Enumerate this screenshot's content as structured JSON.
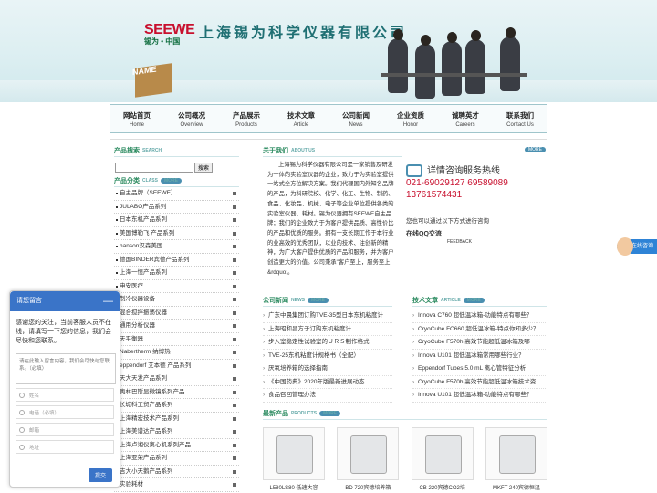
{
  "brand": {
    "logo": "SEEWE",
    "logo_sub": "锡为 • 中国",
    "company": "上海锡为科学仪器有限公司",
    "box_label": "NAME"
  },
  "nav": [
    {
      "zh": "网站首页",
      "en": "Home"
    },
    {
      "zh": "公司概况",
      "en": "Overview"
    },
    {
      "zh": "产品展示",
      "en": "Products"
    },
    {
      "zh": "技术文章",
      "en": "Article"
    },
    {
      "zh": "公司新闻",
      "en": "News"
    },
    {
      "zh": "企业资质",
      "en": "Honor"
    },
    {
      "zh": "诚聘英才",
      "en": "Careers"
    },
    {
      "zh": "联系我们",
      "en": "Contact Us"
    }
  ],
  "sidebar": {
    "search_title": "产品搜索",
    "search_en": "SEARCH",
    "search_button": "搜索",
    "class_title": "产品分类",
    "class_en": "CLASS",
    "more": "MORE",
    "categories": [
      "自主品牌（SEEWE）",
      "JULABO产品系列",
      "日本东机产品系列",
      "美国博勒飞 产品系列",
      "hanson汉森美国",
      "德国BINDER宾德产品系列",
      "上海一恒产品系列",
      "申安医疗",
      "制冷仪器设备",
      "混合搅拌振荡仪器",
      "通用分析仪器",
      "天平衡器",
      "Nabertherm 纳博热",
      "eppendorf 艾本德 产品系列",
      "天大天发产品系列",
      "奥林巴斯显微镜系列产品",
      "长城科工贸产品系列",
      "上海精宏技术产品系列",
      "上海美谱达产品系列",
      "上海卢湘仪离心机系列产品",
      "上海亚荣产品系列",
      "吉大小天鹅产品系列",
      "实验耗材"
    ]
  },
  "about": {
    "title": "关于我们",
    "en": "ABOUT US",
    "more": "MORE",
    "text": "上海锡为科学仪器有限公司是一家销售及研发为一体的实验室仪器的企业，致力于为实验室提供一站式全方位解决方案。我们代理国内外知名品牌的产品，为科研院校、化学、化工、生物、制药、食品、化妆品、机械、电子等企业单位提供各类的实验室仪器、耗材。锡为仪器拥有SEEWE自主品牌；我们的企业致力于为客户提供品质、高性价比的产品和优质的服务。拥有一支长期工作于本行业的业高效的优秀团队，以业的技术、注创新的精神，为广大客户提供优质的产品和服务，并为客户创造更大的价值。公司秉承\"客户至上，服务至上&rdquo;。"
  },
  "contact": {
    "title": "详情咨询服务热线",
    "phone1": "021-69029127 69589089",
    "phone2": "13761574431",
    "qq_text": "您也可以通过以下方式进行咨询",
    "qq_label": "在线QQ交流",
    "qq_brand": "FEEDBACK"
  },
  "news": {
    "title": "公司新闻",
    "en": "NEWS",
    "more": "MORE",
    "items": [
      "广东中晨集团订购TVE-35型日本东机粘度计",
      "上海昭和昌方子订购东机粘度计",
      "步入室稳定性试验室的ＵＲＳ制作格式",
      "TVE-25东机粘度计规格书（全配）",
      "厌氧培养箱的选择指南",
      "《中国药典》2020年版最新进展动态",
      "食品召回管理办法"
    ]
  },
  "tech": {
    "title": "技术文章",
    "en": "ARTICLE",
    "more": "MORE",
    "items": [
      "Innova C760 超低温冰箱-功能特点有哪些？",
      "CryoCube FC660 超低温冰箱-特点你知多少？",
      "CryoCube F570h 高效节能超低温冰箱及哪",
      "Innova U101 超低温冰箱常用哪些行业？",
      "Eppendorf Tubes 5.0 mL 离心管特征分析",
      "CryoCube F570h 高效节能超低温冰箱技术资",
      "Innova U101 超低温冰箱-功能特点有哪些？"
    ]
  },
  "products": {
    "title": "最新产品",
    "en": "PRODUCTS",
    "more": "MORE",
    "items": [
      "L580LS80 低速大容",
      "BD 720宾德培养箱",
      "CB 220宾德CO2培",
      "MKFT 240宾德恒温"
    ]
  },
  "message": {
    "title": "请您留言",
    "minimize": "—",
    "intro": "感谢您的关注，当前客服人员不在线，请填写一下您的信息，我们会尽快和您联系。",
    "textarea_placeholder": "请在此输入留言内容，我们会尽快与您联系。（必填）",
    "fields": [
      "姓名",
      "电话（必填）",
      "邮箱",
      "地址"
    ],
    "submit": "提交"
  },
  "online_label": "在线咨询"
}
